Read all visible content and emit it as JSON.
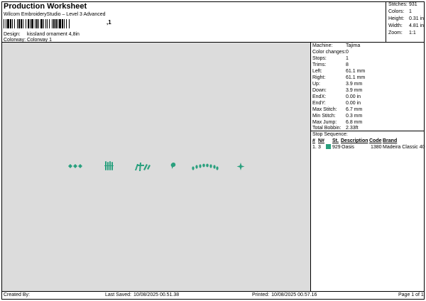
{
  "header": {
    "title": "Production Worksheet",
    "subtitle": "Wilcom EmbroideryStudio – Level 3 Advanced",
    "barcode_suffix": ",1",
    "design_label": "Design:",
    "design_value": "kissland ornament 4,8in",
    "colorway_label": "Colorway:",
    "colorway_value": "Colorway 1"
  },
  "stats": [
    {
      "label": "Stitches:",
      "value": "931"
    },
    {
      "label": "Colors:",
      "value": "1"
    },
    {
      "label": "Height:",
      "value": "0.31 in"
    },
    {
      "label": "Width:",
      "value": "4.81 in"
    },
    {
      "label": "Zoom:",
      "value": "1:1"
    }
  ],
  "properties": [
    {
      "label": "Machine:",
      "value": "Tajima"
    },
    {
      "label": "Color changes:",
      "value": "0"
    },
    {
      "label": "Stops:",
      "value": "1"
    },
    {
      "label": "Trims:",
      "value": "8"
    },
    {
      "label": "Left:",
      "value": "61.1 mm"
    },
    {
      "label": "Right:",
      "value": "61.1 mm"
    },
    {
      "label": "Up:",
      "value": "3.9 mm"
    },
    {
      "label": "Down:",
      "value": "3.9 mm"
    },
    {
      "label": "EndX:",
      "value": "0.00 in"
    },
    {
      "label": "EndY:",
      "value": "0.00 in"
    },
    {
      "label": "Max Stitch:",
      "value": "6.7 mm"
    },
    {
      "label": "Min Stitch:",
      "value": "0.3 mm"
    },
    {
      "label": "Max Jump:",
      "value": "6.8 mm"
    },
    {
      "label": "Total Bobbin:",
      "value": "2.33ft"
    }
  ],
  "stop_sequence": {
    "title": "Stop Sequence:",
    "columns": [
      "#",
      "N#",
      "St.",
      "Description",
      "Code",
      "Brand"
    ],
    "rows": [
      {
        "num": "1.",
        "needle": "3",
        "stitches": "929",
        "description": "Oasis",
        "code": "1380",
        "brand": "Madeira Classic 40",
        "color": "#2aa07e"
      }
    ]
  },
  "design_color": "#2aa07e",
  "footer": {
    "created_by_label": "Created By:",
    "created_by_value": "",
    "last_saved_label": "Last Saved:",
    "last_saved_value": "10/08/2025 00.51.38",
    "printed_label": "Printed:",
    "printed_value": "10/08/2025 00.57.16",
    "page_label": "Page 1 of 1"
  }
}
